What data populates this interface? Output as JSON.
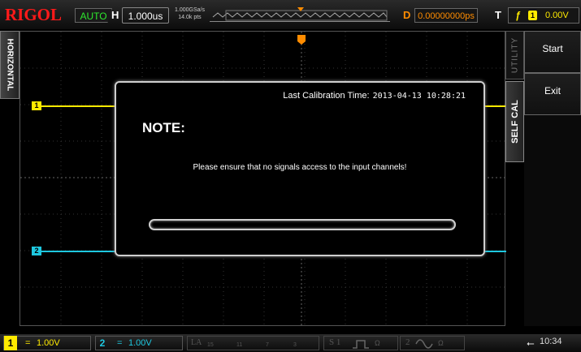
{
  "topbar": {
    "brand": "RIGOL",
    "run_state": "AUTO",
    "horizontal_label": "H",
    "timebase": "1.000us",
    "sample_rate": "1.000GSa/s",
    "memory_depth": "14.0k pts",
    "delay_label": "D",
    "delay_value": "0.00000000ps",
    "trigger_label": "T",
    "trigger_channel": "1",
    "trigger_level": "0.00V"
  },
  "left_tab": {
    "label": "HORIZONTAL"
  },
  "side_tabs": {
    "utility": "UTILITY",
    "self_cal": "SELF CAL"
  },
  "menu": {
    "items": [
      {
        "label": "Start"
      },
      {
        "label": "Exit"
      }
    ]
  },
  "channel_markers": {
    "ch1": "1",
    "ch2": "2"
  },
  "dialog": {
    "calibration_label": "Last Calibration Time:",
    "calibration_time": "2013-04-13 10:28:21",
    "title": "NOTE:",
    "message": "Please ensure that no signals access to the input channels!",
    "progress": 0.0
  },
  "bottombar": {
    "ch1": {
      "num": "1",
      "coupling": "=",
      "scale": "1.00V"
    },
    "ch2": {
      "num": "2",
      "coupling": "=",
      "scale": "1.00V"
    },
    "la": {
      "label": "LA",
      "groups": [
        "15",
        "11",
        "7",
        "3"
      ]
    },
    "source1": {
      "label": "S 1",
      "unit": "Ω"
    },
    "source2": {
      "label": "2",
      "unit": "Ω"
    },
    "clock": "10:34"
  },
  "colors": {
    "ch1": "#ffea00",
    "ch2": "#1ec8e0",
    "brand": "#ff1a1a",
    "run_state": "#2ee82e",
    "delay": "#ff8c00"
  }
}
